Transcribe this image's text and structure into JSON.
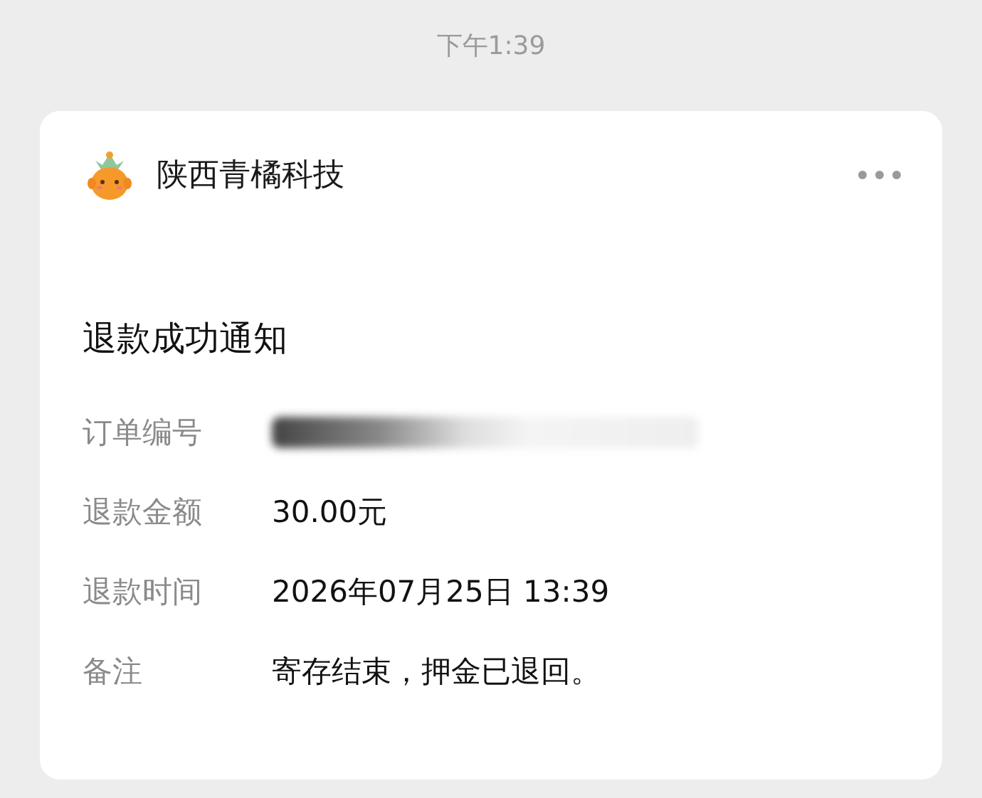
{
  "time": "下午1:39",
  "card": {
    "account": "陕西青橘科技",
    "title": "退款成功通知",
    "rows": [
      {
        "label": "订单编号",
        "kind": "redacted"
      },
      {
        "label": "退款金额",
        "kind": "text",
        "value": "30.00元"
      },
      {
        "label": "退款时间",
        "kind": "text",
        "value": "2026年07月25日 13:39"
      },
      {
        "label": "备注",
        "kind": "text",
        "value": "寄存结束，押金已退回。"
      }
    ]
  }
}
